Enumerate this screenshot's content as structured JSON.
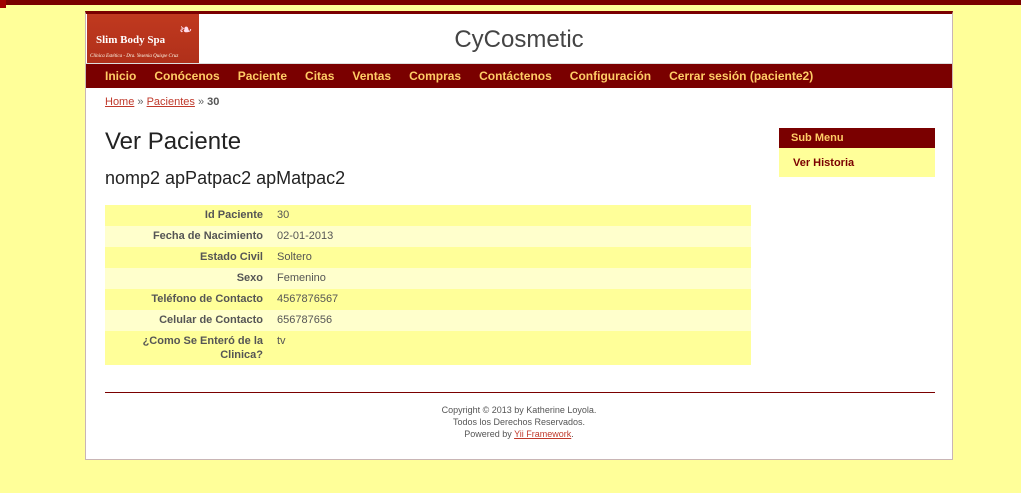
{
  "header": {
    "logo_title": "Slim Body Spa",
    "logo_subtitle": "Clínica Estética - Dra. Yesenia Quispe Cruz",
    "site_title": "CyCosmetic"
  },
  "nav": {
    "items": [
      "Inicio",
      "Conócenos",
      "Paciente",
      "Citas",
      "Ventas",
      "Compras",
      "Contáctenos",
      "Configuración",
      "Cerrar sesión (paciente2)"
    ]
  },
  "breadcrumb": {
    "home": "Home",
    "sep": "»",
    "section": "Pacientes",
    "current": "30"
  },
  "page": {
    "title": "Ver Paciente",
    "subtitle": "nomp2 apPatpac2 apMatpac2"
  },
  "details": [
    {
      "label": "Id Paciente",
      "value": "30"
    },
    {
      "label": "Fecha de Nacimiento",
      "value": "02-01-2013"
    },
    {
      "label": "Estado Civil",
      "value": "Soltero"
    },
    {
      "label": "Sexo",
      "value": "Femenino"
    },
    {
      "label": "Teléfono de Contacto",
      "value": "4567876567"
    },
    {
      "label": "Celular de Contacto",
      "value": "656787656"
    },
    {
      "label": "¿Como Se Enteró de la Clinica?",
      "value": "tv"
    }
  ],
  "sidebar": {
    "title": "Sub Menu",
    "link": "Ver Historia"
  },
  "footer": {
    "copyright": "Copyright © 2013 by Katherine Loyola.",
    "rights": "Todos los Derechos Reservados.",
    "powered_prefix": "Powered by",
    "powered_link": "Yii Framework",
    "powered_suffix": "."
  },
  "colors": {
    "background": "#ffff99",
    "nav": "#7a0000",
    "nav_text": "#ffcc66",
    "logo": "#c0391f"
  }
}
